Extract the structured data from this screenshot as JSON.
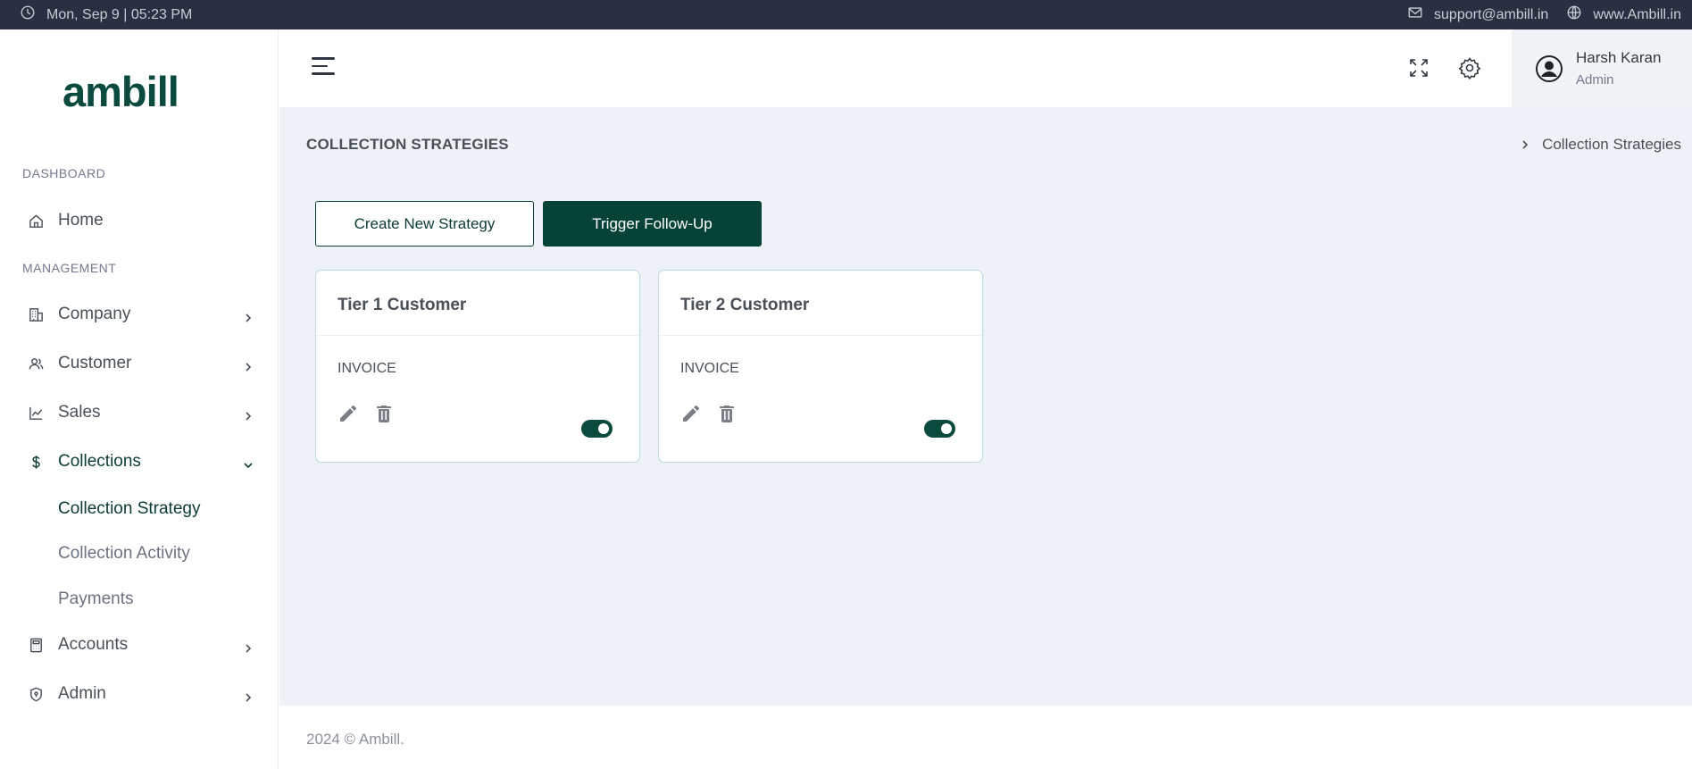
{
  "topbar": {
    "datetime": "Mon, Sep 9 | 05:23 PM",
    "email": "support@ambill.in",
    "website": "www.Ambill.in"
  },
  "brand": {
    "logo_text": "ambill",
    "color": "#0b4a3e"
  },
  "sidebar": {
    "section_dashboard": "DASHBOARD",
    "section_management": "MANAGEMENT",
    "home": "Home",
    "company": "Company",
    "customer": "Customer",
    "sales": "Sales",
    "collections": "Collections",
    "collections_sub": {
      "strategy": "Collection Strategy",
      "activity": "Collection Activity",
      "payments": "Payments"
    },
    "accounts": "Accounts",
    "admin": "Admin"
  },
  "header": {
    "user_name": "Harsh Karan",
    "user_role": "Admin"
  },
  "page": {
    "title": "COLLECTION STRATEGIES",
    "breadcrumb": "Collection Strategies",
    "create_button": "Create New Strategy",
    "trigger_button": "Trigger Follow-Up"
  },
  "cards": [
    {
      "title": "Tier 1 Customer",
      "type": "INVOICE",
      "enabled": true
    },
    {
      "title": "Tier 2 Customer",
      "type": "INVOICE",
      "enabled": true
    }
  ],
  "footer": {
    "text": "2024 © Ambill."
  },
  "colors": {
    "primary": "#074237",
    "topbar": "#2a3042",
    "background": "#eef1f5",
    "card_border": "#b9d9e5"
  }
}
